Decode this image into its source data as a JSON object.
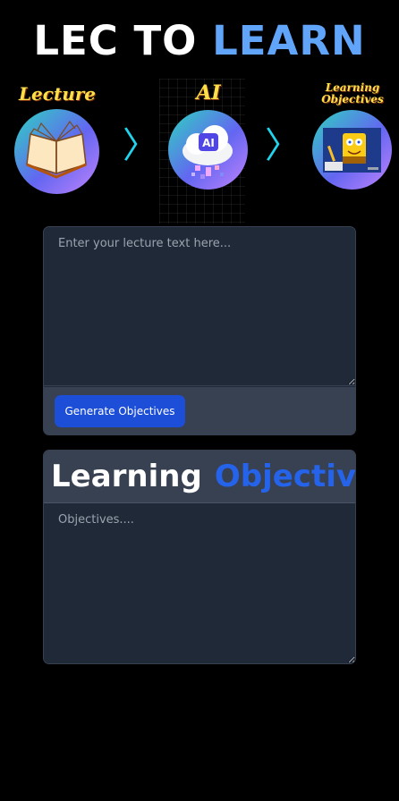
{
  "header": {
    "title_part1": "LEC TO",
    "title_part2": "LEARN"
  },
  "steps": [
    {
      "label": "Lecture",
      "icon": "open-book-icon"
    },
    {
      "label": "AI",
      "icon": "ai-cloud-icon"
    },
    {
      "label": "Learning Objectives",
      "icon": "spongebob-writing-image"
    }
  ],
  "arrows": {
    "glyph": "〉"
  },
  "input": {
    "placeholder": "Enter your lecture text here...",
    "value": ""
  },
  "actions": {
    "generate_label": "Generate Objectives"
  },
  "objectives": {
    "heading_part1": "Learning",
    "heading_part2": "Objectives",
    "placeholder": "Objectives....",
    "value": ""
  },
  "colors": {
    "background": "#000000",
    "title_accent": "#60a5fa",
    "heading_accent": "#2563eb",
    "button": "#1d4ed8",
    "panel": "#1f2937",
    "panel_header": "#374151",
    "step_label": "#fde047",
    "arrow": "#22d3ee"
  }
}
